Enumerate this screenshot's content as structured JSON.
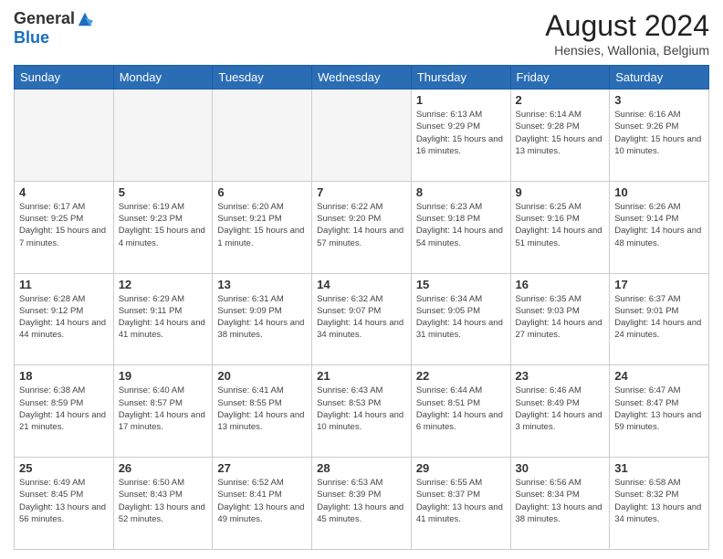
{
  "header": {
    "logo_general": "General",
    "logo_blue": "Blue",
    "month_title": "August 2024",
    "subtitle": "Hensies, Wallonia, Belgium"
  },
  "days_of_week": [
    "Sunday",
    "Monday",
    "Tuesday",
    "Wednesday",
    "Thursday",
    "Friday",
    "Saturday"
  ],
  "weeks": [
    [
      {
        "day": "",
        "info": ""
      },
      {
        "day": "",
        "info": ""
      },
      {
        "day": "",
        "info": ""
      },
      {
        "day": "",
        "info": ""
      },
      {
        "day": "1",
        "info": "Sunrise: 6:13 AM\nSunset: 9:29 PM\nDaylight: 15 hours and 16 minutes."
      },
      {
        "day": "2",
        "info": "Sunrise: 6:14 AM\nSunset: 9:28 PM\nDaylight: 15 hours and 13 minutes."
      },
      {
        "day": "3",
        "info": "Sunrise: 6:16 AM\nSunset: 9:26 PM\nDaylight: 15 hours and 10 minutes."
      }
    ],
    [
      {
        "day": "4",
        "info": "Sunrise: 6:17 AM\nSunset: 9:25 PM\nDaylight: 15 hours and 7 minutes."
      },
      {
        "day": "5",
        "info": "Sunrise: 6:19 AM\nSunset: 9:23 PM\nDaylight: 15 hours and 4 minutes."
      },
      {
        "day": "6",
        "info": "Sunrise: 6:20 AM\nSunset: 9:21 PM\nDaylight: 15 hours and 1 minute."
      },
      {
        "day": "7",
        "info": "Sunrise: 6:22 AM\nSunset: 9:20 PM\nDaylight: 14 hours and 57 minutes."
      },
      {
        "day": "8",
        "info": "Sunrise: 6:23 AM\nSunset: 9:18 PM\nDaylight: 14 hours and 54 minutes."
      },
      {
        "day": "9",
        "info": "Sunrise: 6:25 AM\nSunset: 9:16 PM\nDaylight: 14 hours and 51 minutes."
      },
      {
        "day": "10",
        "info": "Sunrise: 6:26 AM\nSunset: 9:14 PM\nDaylight: 14 hours and 48 minutes."
      }
    ],
    [
      {
        "day": "11",
        "info": "Sunrise: 6:28 AM\nSunset: 9:12 PM\nDaylight: 14 hours and 44 minutes."
      },
      {
        "day": "12",
        "info": "Sunrise: 6:29 AM\nSunset: 9:11 PM\nDaylight: 14 hours and 41 minutes."
      },
      {
        "day": "13",
        "info": "Sunrise: 6:31 AM\nSunset: 9:09 PM\nDaylight: 14 hours and 38 minutes."
      },
      {
        "day": "14",
        "info": "Sunrise: 6:32 AM\nSunset: 9:07 PM\nDaylight: 14 hours and 34 minutes."
      },
      {
        "day": "15",
        "info": "Sunrise: 6:34 AM\nSunset: 9:05 PM\nDaylight: 14 hours and 31 minutes."
      },
      {
        "day": "16",
        "info": "Sunrise: 6:35 AM\nSunset: 9:03 PM\nDaylight: 14 hours and 27 minutes."
      },
      {
        "day": "17",
        "info": "Sunrise: 6:37 AM\nSunset: 9:01 PM\nDaylight: 14 hours and 24 minutes."
      }
    ],
    [
      {
        "day": "18",
        "info": "Sunrise: 6:38 AM\nSunset: 8:59 PM\nDaylight: 14 hours and 21 minutes."
      },
      {
        "day": "19",
        "info": "Sunrise: 6:40 AM\nSunset: 8:57 PM\nDaylight: 14 hours and 17 minutes."
      },
      {
        "day": "20",
        "info": "Sunrise: 6:41 AM\nSunset: 8:55 PM\nDaylight: 14 hours and 13 minutes."
      },
      {
        "day": "21",
        "info": "Sunrise: 6:43 AM\nSunset: 8:53 PM\nDaylight: 14 hours and 10 minutes."
      },
      {
        "day": "22",
        "info": "Sunrise: 6:44 AM\nSunset: 8:51 PM\nDaylight: 14 hours and 6 minutes."
      },
      {
        "day": "23",
        "info": "Sunrise: 6:46 AM\nSunset: 8:49 PM\nDaylight: 14 hours and 3 minutes."
      },
      {
        "day": "24",
        "info": "Sunrise: 6:47 AM\nSunset: 8:47 PM\nDaylight: 13 hours and 59 minutes."
      }
    ],
    [
      {
        "day": "25",
        "info": "Sunrise: 6:49 AM\nSunset: 8:45 PM\nDaylight: 13 hours and 56 minutes."
      },
      {
        "day": "26",
        "info": "Sunrise: 6:50 AM\nSunset: 8:43 PM\nDaylight: 13 hours and 52 minutes."
      },
      {
        "day": "27",
        "info": "Sunrise: 6:52 AM\nSunset: 8:41 PM\nDaylight: 13 hours and 49 minutes."
      },
      {
        "day": "28",
        "info": "Sunrise: 6:53 AM\nSunset: 8:39 PM\nDaylight: 13 hours and 45 minutes."
      },
      {
        "day": "29",
        "info": "Sunrise: 6:55 AM\nSunset: 8:37 PM\nDaylight: 13 hours and 41 minutes."
      },
      {
        "day": "30",
        "info": "Sunrise: 6:56 AM\nSunset: 8:34 PM\nDaylight: 13 hours and 38 minutes."
      },
      {
        "day": "31",
        "info": "Sunrise: 6:58 AM\nSunset: 8:32 PM\nDaylight: 13 hours and 34 minutes."
      }
    ]
  ]
}
